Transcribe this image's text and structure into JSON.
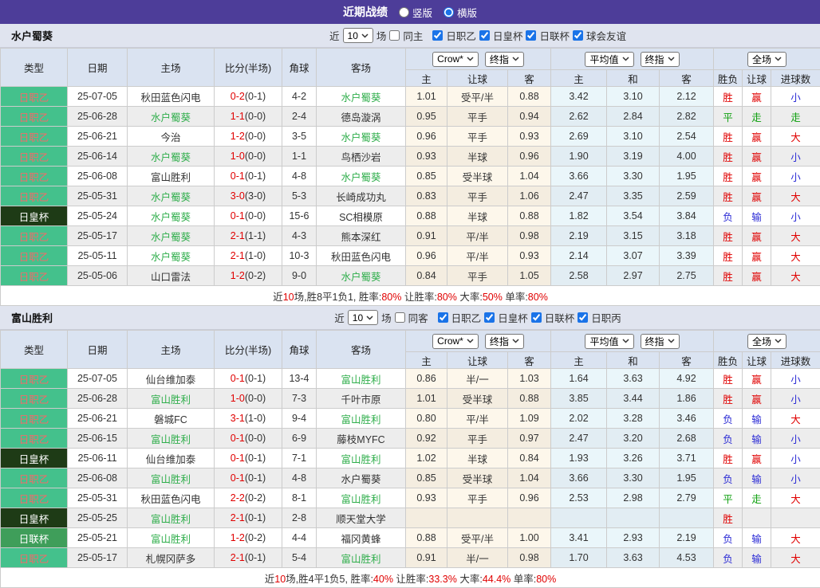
{
  "title_bar": {
    "title": "近期战绩",
    "radios": [
      {
        "label": "竖版",
        "checked": false
      },
      {
        "label": "横版",
        "checked": true
      }
    ]
  },
  "sections": [
    {
      "team": "水户蜀葵",
      "filter": {
        "near_label": "近",
        "count": "10",
        "matches_label": "场",
        "same_label": "同主",
        "same_checked": false,
        "leagues": [
          {
            "label": "日职乙",
            "checked": true
          },
          {
            "label": "日皇杯",
            "checked": true
          },
          {
            "label": "日联杯",
            "checked": true
          },
          {
            "label": "球会友谊",
            "checked": true
          }
        ]
      },
      "dropdowns": {
        "company": "Crow*",
        "final1": "终指",
        "average": "平均值",
        "final2": "终指",
        "fulltime": "全场"
      },
      "columns": {
        "type": "类型",
        "date": "日期",
        "home": "主场",
        "score": "比分(半场)",
        "corner": "角球",
        "away": "客场",
        "crow_home": "主",
        "crow_handicap": "让球",
        "crow_away": "客",
        "avg_home": "主",
        "avg_draw": "和",
        "avg_away": "客",
        "wl": "胜负",
        "handicap": "让球",
        "goals": "进球数"
      },
      "rows": [
        {
          "type": "日职乙",
          "date": "25-07-05",
          "home": "秋田蓝色闪电",
          "home_hl": false,
          "score": "0-2",
          "half": "(0-1)",
          "corner": "4-2",
          "away": "水户蜀葵",
          "away_hl": true,
          "crow": [
            "1.01",
            "受平/半",
            "0.88"
          ],
          "avg": [
            "3.42",
            "3.10",
            "2.12"
          ],
          "result": [
            "胜",
            "赢",
            "小"
          ]
        },
        {
          "type": "日职乙",
          "date": "25-06-28",
          "home": "水户蜀葵",
          "home_hl": true,
          "score": "1-1",
          "half": "(0-0)",
          "corner": "2-4",
          "away": "德岛漩涡",
          "away_hl": false,
          "crow": [
            "0.95",
            "平手",
            "0.94"
          ],
          "avg": [
            "2.62",
            "2.84",
            "2.82"
          ],
          "result": [
            "平",
            "走",
            "走"
          ]
        },
        {
          "type": "日职乙",
          "date": "25-06-21",
          "home": "今治",
          "home_hl": false,
          "score": "1-2",
          "half": "(0-0)",
          "corner": "3-5",
          "away": "水户蜀葵",
          "away_hl": true,
          "crow": [
            "0.96",
            "平手",
            "0.93"
          ],
          "avg": [
            "2.69",
            "3.10",
            "2.54"
          ],
          "result": [
            "胜",
            "赢",
            "大"
          ]
        },
        {
          "type": "日职乙",
          "date": "25-06-14",
          "home": "水户蜀葵",
          "home_hl": true,
          "score": "1-0",
          "half": "(0-0)",
          "corner": "1-1",
          "away": "鸟栖沙岩",
          "away_hl": false,
          "crow": [
            "0.93",
            "半球",
            "0.96"
          ],
          "avg": [
            "1.90",
            "3.19",
            "4.00"
          ],
          "result": [
            "胜",
            "赢",
            "小"
          ]
        },
        {
          "type": "日职乙",
          "date": "25-06-08",
          "home": "富山胜利",
          "home_hl": false,
          "score": "0-1",
          "half": "(0-1)",
          "corner": "4-8",
          "away": "水户蜀葵",
          "away_hl": true,
          "crow": [
            "0.85",
            "受半球",
            "1.04"
          ],
          "avg": [
            "3.66",
            "3.30",
            "1.95"
          ],
          "result": [
            "胜",
            "赢",
            "小"
          ]
        },
        {
          "type": "日职乙",
          "date": "25-05-31",
          "home": "水户蜀葵",
          "home_hl": true,
          "score": "3-0",
          "half": "(3-0)",
          "corner": "5-3",
          "away": "长崎成功丸",
          "away_hl": false,
          "crow": [
            "0.83",
            "平手",
            "1.06"
          ],
          "avg": [
            "2.47",
            "3.35",
            "2.59"
          ],
          "result": [
            "胜",
            "赢",
            "大"
          ]
        },
        {
          "type": "日皇杯",
          "date": "25-05-24",
          "home": "水户蜀葵",
          "home_hl": true,
          "score": "0-1",
          "half": "(0-0)",
          "corner": "15-6",
          "away": "SC相模原",
          "away_hl": false,
          "crow": [
            "0.88",
            "半球",
            "0.88"
          ],
          "avg": [
            "1.82",
            "3.54",
            "3.84"
          ],
          "result": [
            "负",
            "输",
            "小"
          ]
        },
        {
          "type": "日职乙",
          "date": "25-05-17",
          "home": "水户蜀葵",
          "home_hl": true,
          "score": "2-1",
          "half": "(1-1)",
          "corner": "4-3",
          "away": "熊本深红",
          "away_hl": false,
          "crow": [
            "0.91",
            "平/半",
            "0.98"
          ],
          "avg": [
            "2.19",
            "3.15",
            "3.18"
          ],
          "result": [
            "胜",
            "赢",
            "大"
          ]
        },
        {
          "type": "日职乙",
          "date": "25-05-11",
          "home": "水户蜀葵",
          "home_hl": true,
          "score": "2-1",
          "half": "(1-0)",
          "corner": "10-3",
          "away": "秋田蓝色闪电",
          "away_hl": false,
          "crow": [
            "0.96",
            "平/半",
            "0.93"
          ],
          "avg": [
            "2.14",
            "3.07",
            "3.39"
          ],
          "result": [
            "胜",
            "赢",
            "大"
          ]
        },
        {
          "type": "日职乙",
          "date": "25-05-06",
          "home": "山口雷法",
          "home_hl": false,
          "score": "1-2",
          "half": "(0-2)",
          "corner": "9-0",
          "away": "水户蜀葵",
          "away_hl": true,
          "crow": [
            "0.84",
            "平手",
            "1.05"
          ],
          "avg": [
            "2.58",
            "2.97",
            "2.75"
          ],
          "result": [
            "胜",
            "赢",
            "大"
          ]
        }
      ],
      "summary": [
        [
          "近",
          false
        ],
        [
          "10",
          true
        ],
        [
          "场,胜8平1负1, 胜率:",
          false
        ],
        [
          "80%",
          true
        ],
        [
          " 让胜率:",
          false
        ],
        [
          "80%",
          true
        ],
        [
          " 大率:",
          false
        ],
        [
          "50%",
          true
        ],
        [
          " 单率:",
          false
        ],
        [
          "80%",
          true
        ]
      ]
    },
    {
      "team": "富山胜利",
      "filter": {
        "near_label": "近",
        "count": "10",
        "matches_label": "场",
        "same_label": "同客",
        "same_checked": false,
        "leagues": [
          {
            "label": "日职乙",
            "checked": true
          },
          {
            "label": "日皇杯",
            "checked": true
          },
          {
            "label": "日联杯",
            "checked": true
          },
          {
            "label": "日职丙",
            "checked": true
          }
        ]
      },
      "dropdowns": {
        "company": "Crow*",
        "final1": "终指",
        "average": "平均值",
        "final2": "终指",
        "fulltime": "全场"
      },
      "columns": {
        "type": "类型",
        "date": "日期",
        "home": "主场",
        "score": "比分(半场)",
        "corner": "角球",
        "away": "客场",
        "crow_home": "主",
        "crow_handicap": "让球",
        "crow_away": "客",
        "avg_home": "主",
        "avg_draw": "和",
        "avg_away": "客",
        "wl": "胜负",
        "handicap": "让球",
        "goals": "进球数"
      },
      "rows": [
        {
          "type": "日职乙",
          "date": "25-07-05",
          "home": "仙台维加泰",
          "home_hl": false,
          "score": "0-1",
          "half": "(0-1)",
          "corner": "13-4",
          "away": "富山胜利",
          "away_hl": true,
          "crow": [
            "0.86",
            "半/一",
            "1.03"
          ],
          "avg": [
            "1.64",
            "3.63",
            "4.92"
          ],
          "result": [
            "胜",
            "赢",
            "小"
          ]
        },
        {
          "type": "日职乙",
          "date": "25-06-28",
          "home": "富山胜利",
          "home_hl": true,
          "score": "1-0",
          "half": "(0-0)",
          "corner": "7-3",
          "away": "千叶市原",
          "away_hl": false,
          "crow": [
            "1.01",
            "受半球",
            "0.88"
          ],
          "avg": [
            "3.85",
            "3.44",
            "1.86"
          ],
          "result": [
            "胜",
            "赢",
            "小"
          ]
        },
        {
          "type": "日职乙",
          "date": "25-06-21",
          "home": "磐城FC",
          "home_hl": false,
          "score": "3-1",
          "half": "(1-0)",
          "corner": "9-4",
          "away": "富山胜利",
          "away_hl": true,
          "crow": [
            "0.80",
            "平/半",
            "1.09"
          ],
          "avg": [
            "2.02",
            "3.28",
            "3.46"
          ],
          "result": [
            "负",
            "输",
            "大"
          ]
        },
        {
          "type": "日职乙",
          "date": "25-06-15",
          "home": "富山胜利",
          "home_hl": true,
          "score": "0-1",
          "half": "(0-0)",
          "corner": "6-9",
          "away": "藤枝MYFC",
          "away_hl": false,
          "crow": [
            "0.92",
            "平手",
            "0.97"
          ],
          "avg": [
            "2.47",
            "3.20",
            "2.68"
          ],
          "result": [
            "负",
            "输",
            "小"
          ]
        },
        {
          "type": "日皇杯",
          "date": "25-06-11",
          "home": "仙台维加泰",
          "home_hl": false,
          "score": "0-1",
          "half": "(0-1)",
          "corner": "7-1",
          "away": "富山胜利",
          "away_hl": true,
          "crow": [
            "1.02",
            "半球",
            "0.84"
          ],
          "avg": [
            "1.93",
            "3.26",
            "3.71"
          ],
          "result": [
            "胜",
            "赢",
            "小"
          ]
        },
        {
          "type": "日职乙",
          "date": "25-06-08",
          "home": "富山胜利",
          "home_hl": true,
          "score": "0-1",
          "half": "(0-1)",
          "corner": "4-8",
          "away": "水户蜀葵",
          "away_hl": false,
          "crow": [
            "0.85",
            "受半球",
            "1.04"
          ],
          "avg": [
            "3.66",
            "3.30",
            "1.95"
          ],
          "result": [
            "负",
            "输",
            "小"
          ]
        },
        {
          "type": "日职乙",
          "date": "25-05-31",
          "home": "秋田蓝色闪电",
          "home_hl": false,
          "score": "2-2",
          "half": "(0-2)",
          "corner": "8-1",
          "away": "富山胜利",
          "away_hl": true,
          "crow": [
            "0.93",
            "平手",
            "0.96"
          ],
          "avg": [
            "2.53",
            "2.98",
            "2.79"
          ],
          "result": [
            "平",
            "走",
            "大"
          ]
        },
        {
          "type": "日皇杯",
          "date": "25-05-25",
          "home": "富山胜利",
          "home_hl": true,
          "score": "2-1",
          "half": "(0-1)",
          "corner": "2-8",
          "away": "顺天堂大学",
          "away_hl": false,
          "crow": [
            "",
            "",
            ""
          ],
          "avg": [
            "",
            "",
            ""
          ],
          "result": [
            "胜",
            "",
            ""
          ]
        },
        {
          "type": "日联杯",
          "date": "25-05-21",
          "home": "富山胜利",
          "home_hl": true,
          "score": "1-2",
          "half": "(0-2)",
          "corner": "4-4",
          "away": "福冈黄蜂",
          "away_hl": false,
          "crow": [
            "0.88",
            "受平/半",
            "1.00"
          ],
          "avg": [
            "3.41",
            "2.93",
            "2.19"
          ],
          "result": [
            "负",
            "输",
            "大"
          ]
        },
        {
          "type": "日职乙",
          "date": "25-05-17",
          "home": "札幌冈萨多",
          "home_hl": false,
          "score": "2-1",
          "half": "(0-1)",
          "corner": "5-4",
          "away": "富山胜利",
          "away_hl": true,
          "crow": [
            "0.91",
            "半/一",
            "0.98"
          ],
          "avg": [
            "1.70",
            "3.63",
            "4.53"
          ],
          "result": [
            "负",
            "输",
            "大"
          ]
        }
      ],
      "summary": [
        [
          "近",
          false
        ],
        [
          "10",
          true
        ],
        [
          "场,胜4平1负5, 胜率:",
          false
        ],
        [
          "40%",
          true
        ],
        [
          " 让胜率:",
          false
        ],
        [
          "33.3%",
          true
        ],
        [
          " 大率:",
          false
        ],
        [
          "44.4%",
          true
        ],
        [
          " 单率:",
          false
        ],
        [
          "80%",
          true
        ]
      ]
    }
  ]
}
